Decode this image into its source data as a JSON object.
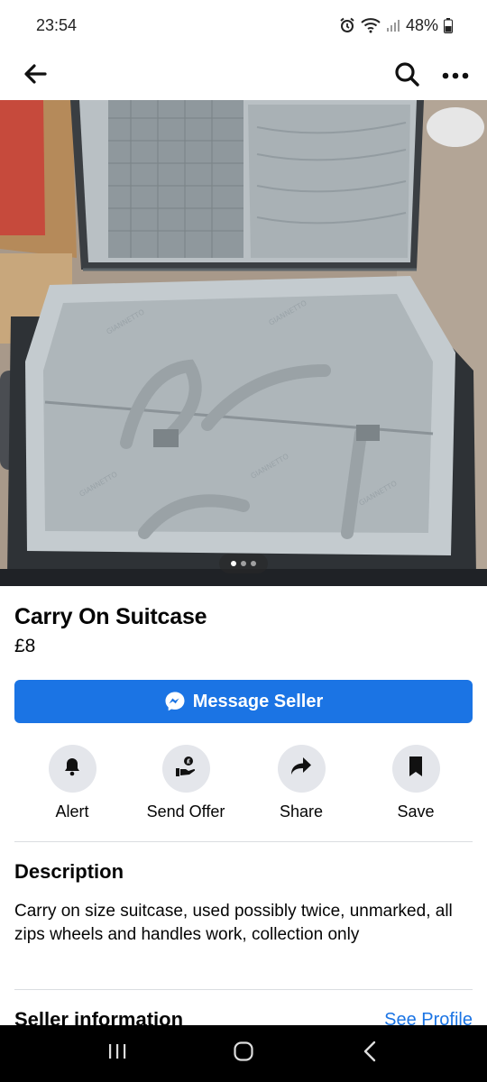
{
  "status_bar": {
    "time": "23:54",
    "battery": "48%"
  },
  "nav": {
    "back_icon": "arrow-left-icon",
    "search_icon": "search-icon",
    "more_icon": "more-horizontal-icon"
  },
  "photo": {
    "carousel_total": 3,
    "carousel_active": 1
  },
  "listing": {
    "title": "Carry On Suitcase",
    "price": "£8"
  },
  "message_button": {
    "label": "Message Seller",
    "icon": "messenger-icon"
  },
  "actions": [
    {
      "label": "Alert",
      "icon": "bell-icon"
    },
    {
      "label": "Send Offer",
      "icon": "send-offer-icon"
    },
    {
      "label": "Share",
      "icon": "share-arrow-icon"
    },
    {
      "label": "Save",
      "icon": "bookmark-icon"
    }
  ],
  "description": {
    "heading": "Description",
    "text": "Carry on size suitcase, used possibly twice, unmarked, all zips wheels and handles work, collection only"
  },
  "seller": {
    "heading": "Seller information",
    "link": "See Profile"
  },
  "colors": {
    "accent": "#1b74e4",
    "action_circle": "#e4e6eb",
    "divider": "#dadde1"
  }
}
